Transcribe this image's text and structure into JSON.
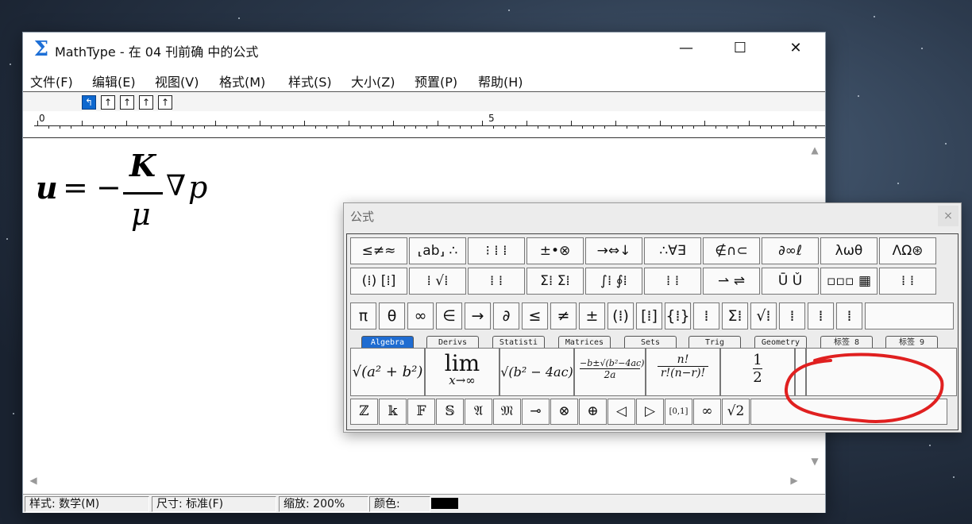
{
  "window": {
    "title": "MathType - 在 04 刊前确 中的公式",
    "app_icon": "Σ",
    "minimize": "—",
    "maximize": "☐",
    "close": "✕"
  },
  "menu": [
    "文件(F)",
    "编辑(E)",
    "视图(V)",
    "格式(M)",
    "样式(S)",
    "大小(Z)",
    "预置(P)",
    "帮助(H)"
  ],
  "toolbar": [
    "↰",
    "↑",
    "↑",
    "↑",
    "↑"
  ],
  "ruler": {
    "label0": "0",
    "label5": "5"
  },
  "formula": {
    "u": "u",
    "eq": "=",
    "minus": "−",
    "num": "K",
    "den": "μ",
    "nabla": "∇",
    "p": "p"
  },
  "status": {
    "style": "样式: 数学(M)",
    "size": "尺寸: 标准(F)",
    "zoom": "缩放: 200%",
    "color": "颜色:"
  },
  "palette": {
    "title": "公式",
    "close": "×",
    "row1": [
      "≤≠≈",
      "⸤ab⸥ ∴",
      "⁝ ⁞ ⁞",
      "±•⊗",
      "→⇔↓",
      "∴∀∃",
      "∉∩⊂",
      "∂∞ℓ",
      "λωθ",
      "ΛΩ⊛"
    ],
    "row2": [
      "(⁞) [⁞]",
      "⁞ √⁞",
      "⁞ ⁞",
      "Σ⁞ Σ⁞",
      "∫⁞ ∮⁞",
      "⁞ ⁞",
      "⇀ ⇌",
      "Ū Ǔ",
      "▫▫▫ ▦",
      "⁞ ⁞"
    ],
    "row3": [
      "π",
      "θ",
      "∞",
      "∈",
      "→",
      "∂",
      "≤",
      "≠",
      "±",
      "(⁞)",
      "[⁞]",
      "{⁞}",
      "⁞",
      "Σ⁞",
      "√⁞",
      "⁞",
      "⁞",
      "⁞"
    ],
    "tabs": [
      "Algebra",
      "Derivs",
      "Statisti",
      "Matrices",
      "Sets",
      "Trig",
      "Geometry",
      "标签 8",
      "标签 9"
    ],
    "templates": {
      "t1": "√(a² + b²)",
      "lim": "lim",
      "lim_sub": "x→∞",
      "t3": "√(b² − 4ac)",
      "quad_num": "−b±√(b²−4ac)",
      "quad_den": "2a",
      "perm_num": "n!",
      "perm_den": "r!(n−r)!",
      "half_num": "1",
      "half_den": "2"
    },
    "row5": [
      "ℤ",
      "𝕜",
      "𝔽",
      "𝕊",
      "𝔄",
      "𝔐",
      "⊸",
      "⊗",
      "⊕",
      "◁",
      "▷",
      "[0,1]",
      "∞",
      "√2"
    ]
  },
  "colors": {
    "accent": "#1f6cd1",
    "annotation": "#e02020"
  }
}
